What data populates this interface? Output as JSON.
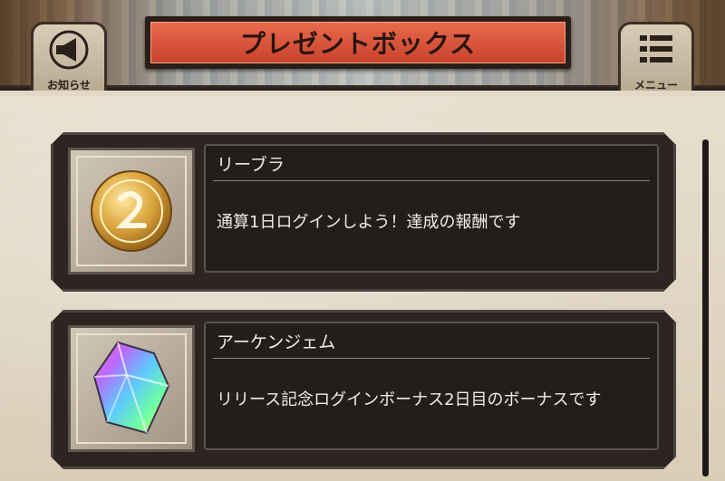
{
  "header": {
    "title": "プレゼントボックス",
    "left_button_label": "お知らせ",
    "right_button_label": "メニュー"
  },
  "presents": [
    {
      "icon": "gold-coin-icon",
      "name": "リーブラ",
      "description": "通算1日ログインしよう！達成の報酬です"
    },
    {
      "icon": "rainbow-gem-icon",
      "name": "アーケンジェム",
      "description": "リリース記念ログインボーナス2日目のボーナスです"
    }
  ],
  "colors": {
    "banner": "#d54e33",
    "panel": "#2c2522",
    "background": "#e3d8c6"
  }
}
